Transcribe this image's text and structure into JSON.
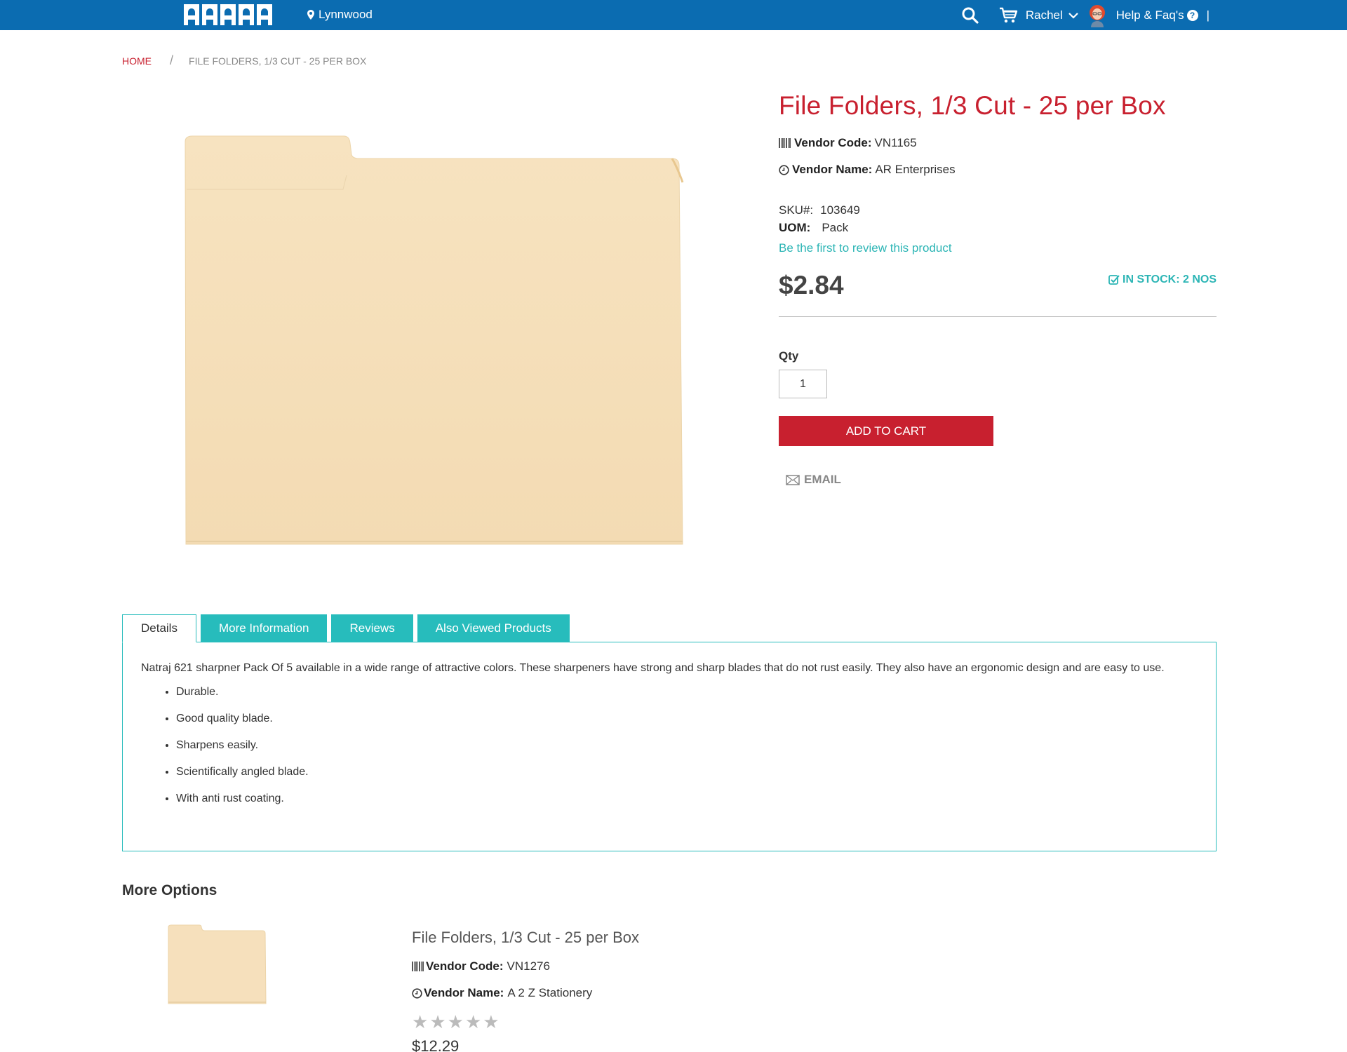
{
  "header": {
    "location": "Lynnwood",
    "user_name": "Rachel",
    "help_label": "Help & Faq's",
    "pipe": "|",
    "colors": {
      "bar": "#0b6cb1",
      "accent_red": "#c8202f",
      "teal": "#27bcbc"
    }
  },
  "breadcrumb": {
    "home": "HOME",
    "separator": "/",
    "current": "FILE FOLDERS, 1/3 CUT - 25 PER BOX"
  },
  "product": {
    "title": "File Folders, 1/3 Cut - 25 per Box",
    "vendor_code_label": "Vendor Code:",
    "vendor_code": "VN1165",
    "vendor_name_label": "Vendor Name:",
    "vendor_name": "AR Enterprises",
    "sku_label": "SKU#:",
    "sku": "103649",
    "uom_label": "UOM:",
    "uom": "Pack",
    "review_link": "Be the first to review this product",
    "price": "$2.84",
    "stock": "IN STOCK: 2 NOS",
    "qty_label": "Qty",
    "qty_value": "1",
    "add_to_cart": "ADD TO CART",
    "email": "EMAIL"
  },
  "tabs": [
    {
      "label": "Details"
    },
    {
      "label": "More Information"
    },
    {
      "label": "Reviews"
    },
    {
      "label": "Also Viewed Products"
    }
  ],
  "details": {
    "description": "Natraj 621 sharpner Pack Of 5 available in a wide range of attractive colors. These sharpeners have strong and sharp blades that do not rust easily. They also have an ergonomic design and are easy to use.",
    "bullets": [
      "Durable.",
      "Good quality blade.",
      "Sharpens easily.",
      "Scientifically angled blade.",
      "With anti rust coating."
    ]
  },
  "more_options": {
    "title": "More Options",
    "item": {
      "title": "File Folders, 1/3 Cut - 25 per Box",
      "vendor_code_label": "Vendor Code:",
      "vendor_code": "VN1276",
      "vendor_name_label": "Vendor Name:",
      "vendor_name": "A 2 Z Stationery",
      "rating": 0,
      "price": "$12.29"
    }
  }
}
